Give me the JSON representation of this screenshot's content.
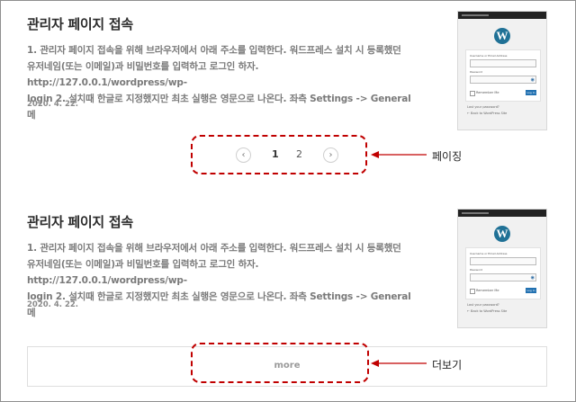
{
  "posts": [
    {
      "title": "관리자 페이지 접속",
      "excerpt": "1. 관리자 페이지 접속을 위해 브라우저에서 아래 주소를 입력한다. 워드프레스 설치 시 등록했던\n유저네임(또는 이메일)과 비밀번호를 입력하고 로그인 하자. http://127.0.0.1/wordpress/wp-\nlogin 2. 설치때 한글로 지정했지만 최초 실행은 영문으로 나온다. 좌측 Settings -> General 메",
      "date": "2020. 4. 22.",
      "thumbnail": {
        "logo": "W",
        "username_label": "Username or Email Address",
        "password_label": "Password",
        "remember_label": "Remember Me",
        "login_button": "Log In",
        "lost_password": "Lost your password?",
        "back_link": "← Back to WordPress Site"
      }
    },
    {
      "title": "관리자 페이지 접속",
      "excerpt": "1. 관리자 페이지 접속을 위해 브라우저에서 아래 주소를 입력한다. 워드프레스 설치 시 등록했던\n유저네임(또는 이메일)과 비밀번호를 입력하고 로그인 하자. http://127.0.0.1/wordpress/wp-\nlogin 2. 설치때 한글로 지정했지만 최초 실행은 영문으로 나온다. 좌측 Settings -> General 메",
      "date": "2020. 4. 22.",
      "thumbnail": {
        "logo": "W",
        "username_label": "Username or Email Address",
        "password_label": "Password",
        "remember_label": "Remember Me",
        "login_button": "Log In",
        "lost_password": "Lost your password?",
        "back_link": "← Back to WordPress Site"
      }
    }
  ],
  "pagination": {
    "prev_icon": "‹",
    "pages": [
      "1",
      "2"
    ],
    "current_page": "1",
    "next_icon": "›"
  },
  "more": {
    "label": "more"
  },
  "callouts": {
    "paging": "페이징",
    "more": "더보기"
  },
  "colors": {
    "highlight": "#c00000",
    "wp_blue": "#207196"
  }
}
